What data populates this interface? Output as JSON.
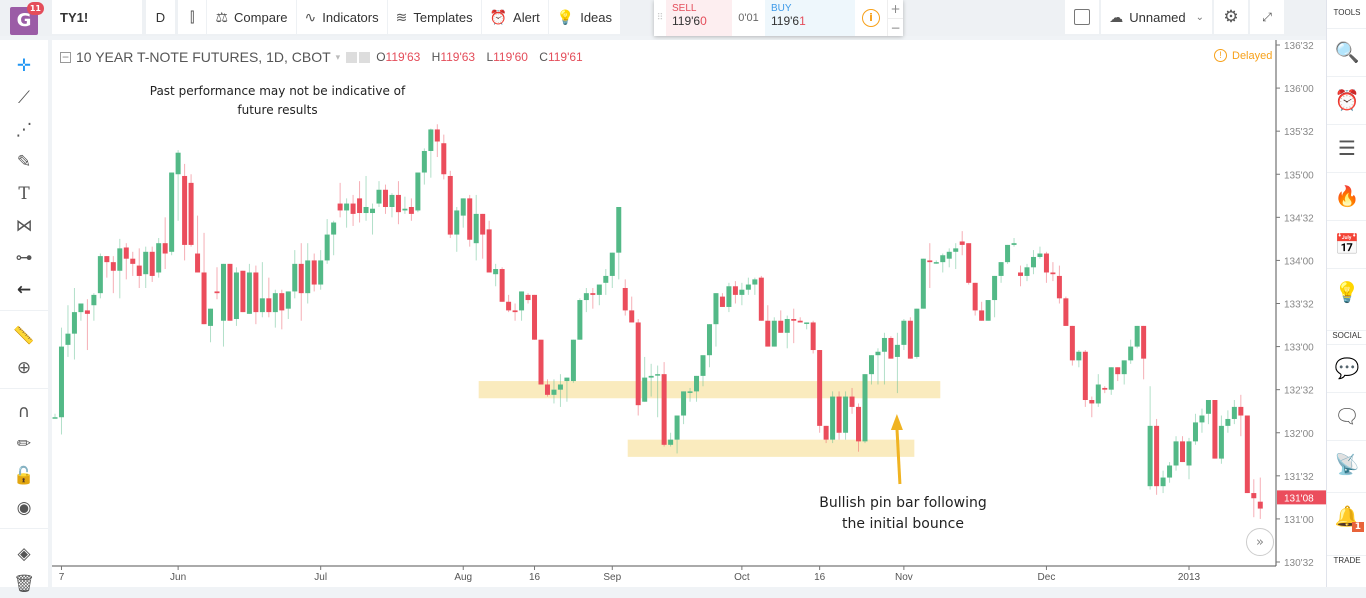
{
  "topbar": {
    "logo_badge": "11",
    "symbol": "TY1!",
    "interval": "D",
    "items": [
      {
        "icon": "candles-icon",
        "label": ""
      },
      {
        "icon": "compare-icon",
        "label": "Compare"
      },
      {
        "icon": "indicators-icon",
        "label": "Indicators"
      },
      {
        "icon": "templates-icon",
        "label": "Templates"
      },
      {
        "icon": "alert-icon",
        "label": "Alert"
      },
      {
        "icon": "ideas-icon",
        "label": "Ideas"
      }
    ],
    "trade": {
      "sell_label": "SELL",
      "sell_price_main": "119'6",
      "sell_price_last": "0",
      "spread": "0'01",
      "buy_label": "BUY",
      "buy_price_main": "119'6",
      "buy_price_last": "1",
      "info_icon": "i",
      "plus": "+",
      "minus": "−"
    },
    "layout_name": "Unnamed"
  },
  "left_tools": [
    "crosshair-icon",
    "trend-line-icon",
    "pitchfork-icon",
    "brush-icon",
    "text-icon",
    "pattern-icon",
    "prediction-icon",
    "back-arrow-icon",
    "ruler-icon",
    "zoom-in-icon",
    "magnet-icon",
    "lock-drawing-icon",
    "lock-icon",
    "eye-icon",
    "layers-icon",
    "trash-icon"
  ],
  "right_sidebar": {
    "tools_label": "TOOLS",
    "social_label": "SOCIAL",
    "trade_label": "TRADE",
    "notification_count": "1"
  },
  "chart": {
    "legend_title": "10 YEAR T-NOTE FUTURES, 1D, CBOT",
    "ohlc": [
      {
        "k": "O",
        "v": "119'63"
      },
      {
        "k": "H",
        "v": "119'63"
      },
      {
        "k": "L",
        "v": "119'60"
      },
      {
        "k": "C",
        "v": "119'61"
      }
    ],
    "delayed_label": "Delayed",
    "disclaimer": "Past performance may not be indicative of future results",
    "annotation": "Bullish pin bar following the initial bounce",
    "last_price_label": "131'08",
    "scroll_button": "»",
    "colors": {
      "up": "#53b987",
      "down": "#eb4d5c",
      "zone": "#f9e7b3",
      "arrow": "#f0b322",
      "last_price": "#eb4d5c"
    }
  },
  "chart_data": {
    "type": "candlestick",
    "title": "10 YEAR T-NOTE FUTURES, 1D, CBOT",
    "y_ticks": [
      "136'32",
      "136'00",
      "135'32",
      "135'00",
      "134'32",
      "134'00",
      "133'32",
      "133'00",
      "132'32",
      "132'00",
      "131'32",
      "131'00",
      "130'32"
    ],
    "y_tick_values": [
      136.5,
      136.0,
      135.5,
      135.0,
      134.5,
      134.0,
      133.5,
      133.0,
      132.5,
      132.0,
      131.5,
      131.0,
      130.5
    ],
    "ylim": [
      130.25,
      136.62
    ],
    "x_ticks": [
      {
        "label": "7",
        "index": 1
      },
      {
        "label": "Jun",
        "index": 19
      },
      {
        "label": "Jul",
        "index": 41
      },
      {
        "label": "Aug",
        "index": 63
      },
      {
        "label": "16",
        "index": 74
      },
      {
        "label": "Sep",
        "index": 86
      },
      {
        "label": "Oct",
        "index": 106
      },
      {
        "label": "16",
        "index": 118
      },
      {
        "label": "Nov",
        "index": 131
      },
      {
        "label": "Dec",
        "index": 153
      },
      {
        "label": "2013",
        "index": 175
      }
    ],
    "zones": [
      {
        "from_index": 66,
        "to_index": 136,
        "low": 132.4,
        "high": 132.6
      },
      {
        "from_index": 89,
        "to_index": 132,
        "low": 131.72,
        "high": 131.92
      }
    ],
    "annotation_arrow_index": 129,
    "last_price": 131.25,
    "candles": [
      [
        132.18,
        132.22,
        132.18,
        132.18
      ],
      [
        132.18,
        133.22,
        131.98,
        133.0
      ],
      [
        133.02,
        133.48,
        132.88,
        133.15
      ],
      [
        133.15,
        133.68,
        132.85,
        133.4
      ],
      [
        133.4,
        133.5,
        133.3,
        133.5
      ],
      [
        133.42,
        133.55,
        132.96,
        133.38
      ],
      [
        133.48,
        133.62,
        133.3,
        133.6
      ],
      [
        133.62,
        134.08,
        133.56,
        134.05
      ],
      [
        134.05,
        134.05,
        133.8,
        133.98
      ],
      [
        133.98,
        134.05,
        133.62,
        133.88
      ],
      [
        133.88,
        134.25,
        133.56,
        134.14
      ],
      [
        134.15,
        134.2,
        133.78,
        134.02
      ],
      [
        134.02,
        134.1,
        133.82,
        133.96
      ],
      [
        133.94,
        134.14,
        133.68,
        133.82
      ],
      [
        133.84,
        134.16,
        133.68,
        134.1
      ],
      [
        134.1,
        134.16,
        133.75,
        133.82
      ],
      [
        133.86,
        134.26,
        133.8,
        134.2
      ],
      [
        134.2,
        134.5,
        133.9,
        134.08
      ],
      [
        134.1,
        135.02,
        134.06,
        135.02
      ],
      [
        135.0,
        135.28,
        134.46,
        135.25
      ],
      [
        134.98,
        135.12,
        134.0,
        134.18
      ],
      [
        134.9,
        135.0,
        134.16,
        134.18
      ],
      [
        134.08,
        134.52,
        133.88,
        133.86
      ],
      [
        133.86,
        134.32,
        133.4,
        133.26
      ],
      [
        133.24,
        133.4,
        133.05,
        133.44
      ],
      [
        133.64,
        133.92,
        133.55,
        133.62
      ],
      [
        133.3,
        133.9,
        133.0,
        133.96
      ],
      [
        133.96,
        133.94,
        133.32,
        133.3
      ],
      [
        133.32,
        133.92,
        133.24,
        133.86
      ],
      [
        133.88,
        133.8,
        133.4,
        133.4
      ],
      [
        133.38,
        133.96,
        133.4,
        133.86
      ],
      [
        133.86,
        133.94,
        133.26,
        133.4
      ],
      [
        133.4,
        133.98,
        133.34,
        133.56
      ],
      [
        133.56,
        133.8,
        133.34,
        133.4
      ],
      [
        133.4,
        133.66,
        133.22,
        133.62
      ],
      [
        133.62,
        133.66,
        133.2,
        133.42
      ],
      [
        133.44,
        133.64,
        133.32,
        133.64
      ],
      [
        133.64,
        134.12,
        133.56,
        133.96
      ],
      [
        133.96,
        134.2,
        133.3,
        133.62
      ],
      [
        133.62,
        134.2,
        133.5,
        134.0
      ],
      [
        134.0,
        134.08,
        133.64,
        133.72
      ],
      [
        133.72,
        134.12,
        133.66,
        134.0
      ],
      [
        134.0,
        134.48,
        133.96,
        134.3
      ],
      [
        134.3,
        134.46,
        134.06,
        134.44
      ],
      [
        134.66,
        134.9,
        134.5,
        134.58
      ],
      [
        134.58,
        134.72,
        134.38,
        134.66
      ],
      [
        134.66,
        134.76,
        134.4,
        134.54
      ],
      [
        134.72,
        134.92,
        134.44,
        134.55
      ],
      [
        134.55,
        134.98,
        134.46,
        134.62
      ],
      [
        134.55,
        134.66,
        134.3,
        134.6
      ],
      [
        134.66,
        134.92,
        134.62,
        134.82
      ],
      [
        134.82,
        134.88,
        134.54,
        134.62
      ],
      [
        134.62,
        134.78,
        134.5,
        134.76
      ],
      [
        134.76,
        134.92,
        134.42,
        134.56
      ],
      [
        134.58,
        134.74,
        134.54,
        134.6
      ],
      [
        134.62,
        134.72,
        134.46,
        134.54
      ],
      [
        134.58,
        135.02,
        134.56,
        135.02
      ],
      [
        135.02,
        135.3,
        134.88,
        135.27
      ],
      [
        135.27,
        135.53,
        134.96,
        135.52
      ],
      [
        135.52,
        135.58,
        135.2,
        135.38
      ],
      [
        135.36,
        135.46,
        134.94,
        135.0
      ],
      [
        134.98,
        135.04,
        134.26,
        134.3
      ],
      [
        134.3,
        134.62,
        134.1,
        134.58
      ],
      [
        134.52,
        134.72,
        134.38,
        134.72
      ],
      [
        134.72,
        134.76,
        134.16,
        134.24
      ],
      [
        134.2,
        134.76,
        134.0,
        134.54
      ],
      [
        134.54,
        134.48,
        134.02,
        134.3
      ],
      [
        134.36,
        134.46,
        133.88,
        133.86
      ],
      [
        133.84,
        133.96,
        133.7,
        133.9
      ],
      [
        133.9,
        133.92,
        133.6,
        133.52
      ],
      [
        133.52,
        133.6,
        133.4,
        133.42
      ],
      [
        133.42,
        133.5,
        133.3,
        133.4
      ],
      [
        133.42,
        133.6,
        133.3,
        133.64
      ],
      [
        133.6,
        133.62,
        133.5,
        133.54
      ],
      [
        133.6,
        133.6,
        133.1,
        133.08
      ],
      [
        133.08,
        133.04,
        132.66,
        132.56
      ],
      [
        132.56,
        132.62,
        132.42,
        132.44
      ],
      [
        132.44,
        132.62,
        132.34,
        132.5
      ],
      [
        132.5,
        132.68,
        132.3,
        132.56
      ],
      [
        132.6,
        132.64,
        132.36,
        132.64
      ],
      [
        132.6,
        133.08,
        132.58,
        133.08
      ],
      [
        133.08,
        133.56,
        133.1,
        133.54
      ],
      [
        133.54,
        133.68,
        133.4,
        133.62
      ],
      [
        133.62,
        133.68,
        133.44,
        133.6
      ],
      [
        133.6,
        133.7,
        133.48,
        133.72
      ],
      [
        133.74,
        133.9,
        133.6,
        133.82
      ],
      [
        133.82,
        134.08,
        133.68,
        134.09
      ],
      [
        134.09,
        134.38,
        133.78,
        134.62
      ],
      [
        133.68,
        133.78,
        133.36,
        133.42
      ],
      [
        133.42,
        133.58,
        133.3,
        133.28
      ],
      [
        133.28,
        133.32,
        132.2,
        132.32
      ],
      [
        132.36,
        132.88,
        132.54,
        132.64
      ],
      [
        132.64,
        132.8,
        132.42,
        132.66
      ],
      [
        132.68,
        132.78,
        132.18,
        132.68
      ],
      [
        132.68,
        132.82,
        131.84,
        131.86
      ],
      [
        131.86,
        132.0,
        131.84,
        131.92
      ],
      [
        131.92,
        132.06,
        131.76,
        132.2
      ],
      [
        132.2,
        132.4,
        132.1,
        132.48
      ],
      [
        132.48,
        132.52,
        132.36,
        132.48
      ],
      [
        132.48,
        132.62,
        132.36,
        132.66
      ],
      [
        132.66,
        132.8,
        132.54,
        132.9
      ],
      [
        132.9,
        133.14,
        132.76,
        133.26
      ],
      [
        133.26,
        133.46,
        133.0,
        133.62
      ],
      [
        133.58,
        133.62,
        133.48,
        133.46
      ],
      [
        133.46,
        133.74,
        133.4,
        133.7
      ],
      [
        133.7,
        133.76,
        133.5,
        133.6
      ],
      [
        133.6,
        133.74,
        133.48,
        133.66
      ],
      [
        133.66,
        133.8,
        133.6,
        133.72
      ],
      [
        133.72,
        133.8,
        133.6,
        133.78
      ],
      [
        133.8,
        133.82,
        133.3,
        133.3
      ],
      [
        133.3,
        133.48,
        133.18,
        133.0
      ],
      [
        133.0,
        133.34,
        133.0,
        133.3
      ],
      [
        133.3,
        133.42,
        133.2,
        133.16
      ],
      [
        133.16,
        133.36,
        132.98,
        133.32
      ],
      [
        133.32,
        133.44,
        133.04,
        133.3
      ],
      [
        133.3,
        133.34,
        133.28,
        133.28
      ],
      [
        133.28,
        133.28,
        133.2,
        133.28
      ],
      [
        133.28,
        133.3,
        132.92,
        132.96
      ],
      [
        132.96,
        132.88,
        132.0,
        132.08
      ],
      [
        132.08,
        132.0,
        131.88,
        131.92
      ],
      [
        131.92,
        132.48,
        131.88,
        132.42
      ],
      [
        132.42,
        132.48,
        131.92,
        132.0
      ],
      [
        132.0,
        132.48,
        131.92,
        132.42
      ],
      [
        132.42,
        132.52,
        132.22,
        132.3
      ],
      [
        132.3,
        132.34,
        131.78,
        131.9
      ],
      [
        131.9,
        132.62,
        131.88,
        132.68
      ],
      [
        132.68,
        132.78,
        132.56,
        132.9
      ],
      [
        132.9,
        132.98,
        132.56,
        132.94
      ],
      [
        132.94,
        133.16,
        132.56,
        133.1
      ],
      [
        133.1,
        133.12,
        132.86,
        132.86
      ],
      [
        132.88,
        133.16,
        132.46,
        133.02
      ],
      [
        133.02,
        133.32,
        132.96,
        133.3
      ],
      [
        133.3,
        133.34,
        132.86,
        132.86
      ],
      [
        132.88,
        133.42,
        132.86,
        133.44
      ],
      [
        133.44,
        133.9,
        133.44,
        134.02
      ],
      [
        134.0,
        134.2,
        133.68,
        133.98
      ],
      [
        133.98,
        134.0,
        133.96,
        133.98
      ],
      [
        133.98,
        134.08,
        133.86,
        134.06
      ],
      [
        134.02,
        134.14,
        133.92,
        134.1
      ],
      [
        134.1,
        134.2,
        133.9,
        134.14
      ],
      [
        134.22,
        134.34,
        134.06,
        134.18
      ],
      [
        134.2,
        134.14,
        133.72,
        133.74
      ],
      [
        133.74,
        133.72,
        133.36,
        133.42
      ],
      [
        133.42,
        133.52,
        133.34,
        133.3
      ],
      [
        133.3,
        133.5,
        133.34,
        133.54
      ],
      [
        133.54,
        133.7,
        133.34,
        133.82
      ],
      [
        133.82,
        133.98,
        133.74,
        133.98
      ],
      [
        133.98,
        134.16,
        133.96,
        134.18
      ],
      [
        134.18,
        134.26,
        134.16,
        134.2
      ],
      [
        133.86,
        133.94,
        133.7,
        133.82
      ],
      [
        133.82,
        133.96,
        133.76,
        133.92
      ],
      [
        133.92,
        134.12,
        133.84,
        134.04
      ],
      [
        134.04,
        134.16,
        134.02,
        134.08
      ],
      [
        134.08,
        134.1,
        133.74,
        133.86
      ],
      [
        133.86,
        133.98,
        133.76,
        133.84
      ],
      [
        133.82,
        133.94,
        133.5,
        133.56
      ],
      [
        133.56,
        133.58,
        133.36,
        133.24
      ],
      [
        133.24,
        133.12,
        132.78,
        132.84
      ],
      [
        132.84,
        132.96,
        132.76,
        132.94
      ],
      [
        132.94,
        132.96,
        132.3,
        132.38
      ],
      [
        132.38,
        132.42,
        132.18,
        132.34
      ],
      [
        132.34,
        132.68,
        132.3,
        132.56
      ],
      [
        132.52,
        132.54,
        132.46,
        132.5
      ],
      [
        132.5,
        132.72,
        132.44,
        132.76
      ],
      [
        132.76,
        132.76,
        132.6,
        132.68
      ],
      [
        132.68,
        132.84,
        132.56,
        132.84
      ],
      [
        132.84,
        133.08,
        132.8,
        133.0
      ],
      [
        133.0,
        133.16,
        132.98,
        133.24
      ],
      [
        133.24,
        133.2,
        132.62,
        132.86
      ],
      [
        131.38,
        132.54,
        131.34,
        132.08
      ],
      [
        132.08,
        132.16,
        131.28,
        131.38
      ],
      [
        131.38,
        131.56,
        131.3,
        131.48
      ],
      [
        131.48,
        131.66,
        131.42,
        131.62
      ],
      [
        131.62,
        131.96,
        131.56,
        131.9
      ],
      [
        131.9,
        131.96,
        131.7,
        131.66
      ],
      [
        131.62,
        131.94,
        131.46,
        131.9
      ],
      [
        131.9,
        132.22,
        131.86,
        132.12
      ],
      [
        132.12,
        132.28,
        132.0,
        132.2
      ],
      [
        132.22,
        132.38,
        132.1,
        132.38
      ],
      [
        132.38,
        132.38,
        131.7,
        131.7
      ],
      [
        131.7,
        132.2,
        131.64,
        132.08
      ],
      [
        132.08,
        132.26,
        132.0,
        132.16
      ],
      [
        132.16,
        132.38,
        132.1,
        132.3
      ],
      [
        132.3,
        132.44,
        131.96,
        132.2
      ],
      [
        132.2,
        132.12,
        131.3,
        131.3
      ],
      [
        131.3,
        131.46,
        131.02,
        131.24
      ],
      [
        131.2,
        131.48,
        131.0,
        131.12
      ]
    ]
  }
}
